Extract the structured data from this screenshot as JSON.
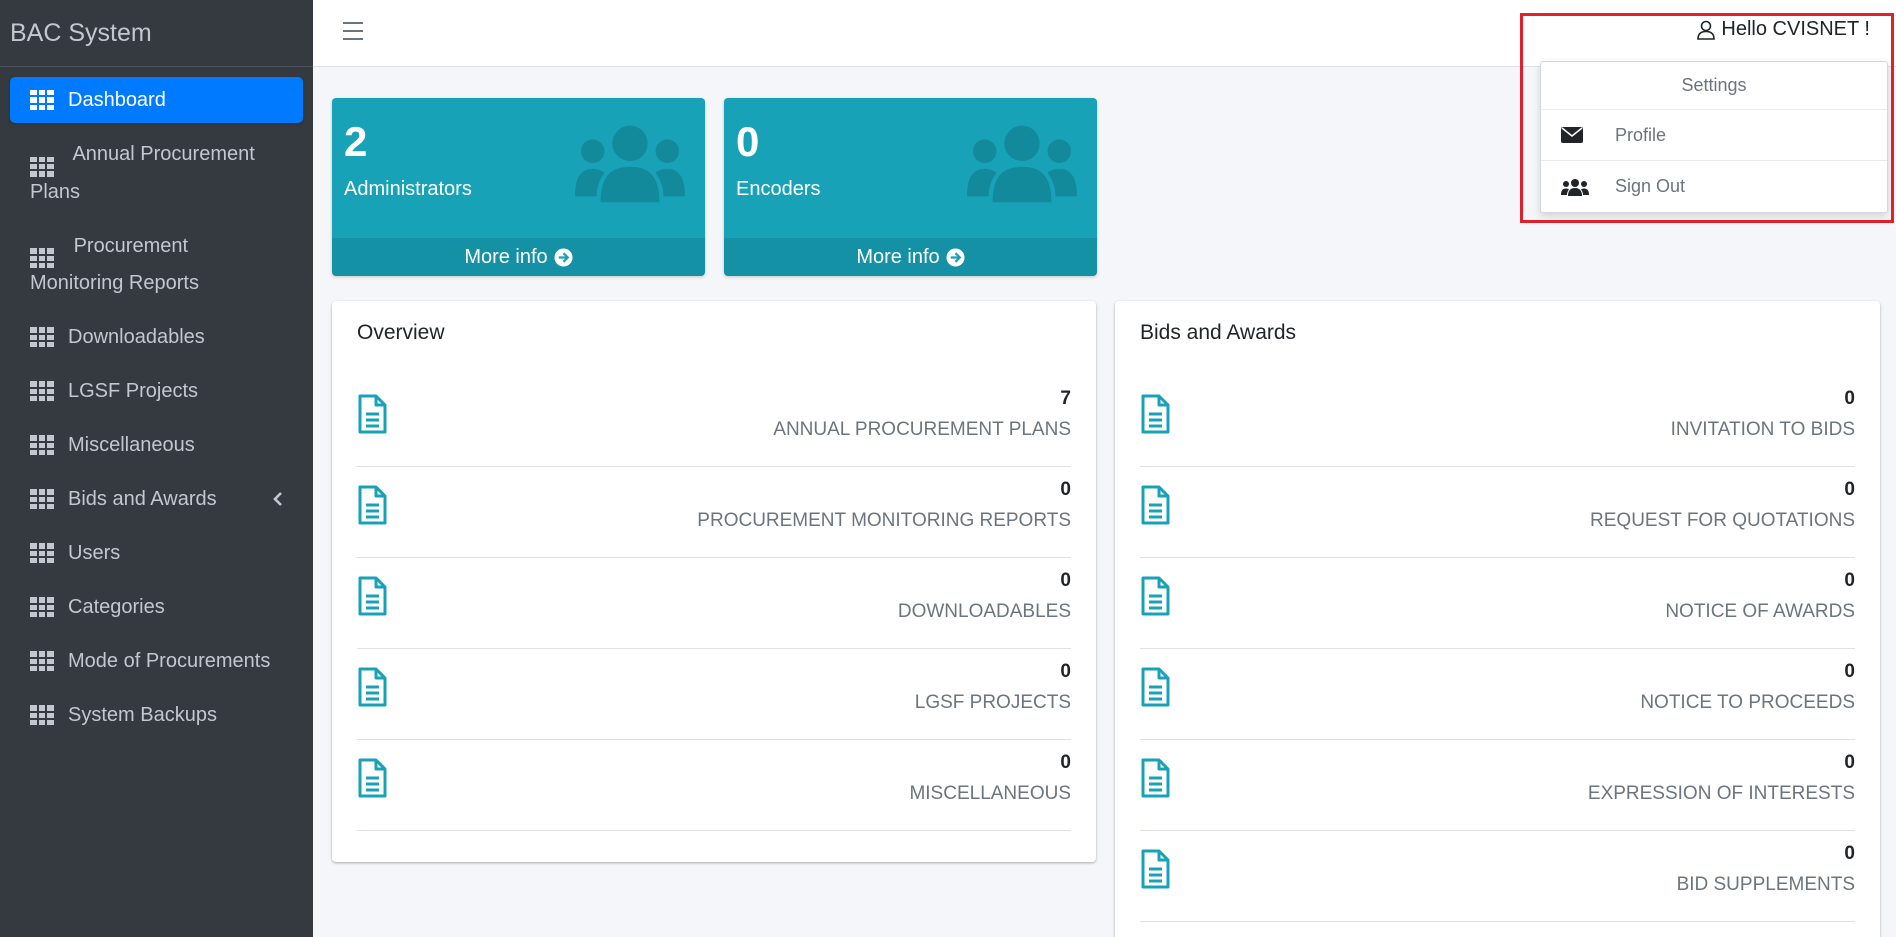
{
  "brand": "BAC System",
  "sidebar": {
    "items": [
      {
        "label": "Dashboard"
      },
      {
        "label": "Annual Procurement Plans"
      },
      {
        "label": "Procurement Monitoring Reports"
      },
      {
        "label": "Downloadables"
      },
      {
        "label": "LGSF Projects"
      },
      {
        "label": "Miscellaneous"
      },
      {
        "label": "Bids and Awards"
      },
      {
        "label": "Users"
      },
      {
        "label": "Categories"
      },
      {
        "label": "Mode of Procurements"
      },
      {
        "label": "System Backups"
      }
    ]
  },
  "header": {
    "greeting": "Hello CVISNET !",
    "dropdown": {
      "header": "Settings",
      "profile": "Profile",
      "signout": "Sign Out"
    }
  },
  "boxes": [
    {
      "count": "2",
      "label": "Administrators",
      "footer": "More info"
    },
    {
      "count": "0",
      "label": "Encoders",
      "footer": "More info"
    }
  ],
  "overview": {
    "title": "Overview",
    "rows": [
      {
        "count": "7",
        "label": "ANNUAL PROCUREMENT PLANS"
      },
      {
        "count": "0",
        "label": "PROCUREMENT MONITORING REPORTS"
      },
      {
        "count": "0",
        "label": "DOWNLOADABLES"
      },
      {
        "count": "0",
        "label": "LGSF PROJECTS"
      },
      {
        "count": "0",
        "label": "MISCELLANEOUS"
      }
    ]
  },
  "bids": {
    "title": "Bids and Awards",
    "rows": [
      {
        "count": "0",
        "label": "INVITATION TO BIDS"
      },
      {
        "count": "0",
        "label": "REQUEST FOR QUOTATIONS"
      },
      {
        "count": "0",
        "label": "NOTICE OF AWARDS"
      },
      {
        "count": "0",
        "label": "NOTICE TO PROCEEDS"
      },
      {
        "count": "0",
        "label": "EXPRESSION OF INTERESTS"
      },
      {
        "count": "0",
        "label": "BID SUPPLEMENTS"
      }
    ]
  },
  "colors": {
    "sidebar": "#343a40",
    "active": "#007bff",
    "info": "#17a2b8",
    "highlight": "#e0202a"
  }
}
